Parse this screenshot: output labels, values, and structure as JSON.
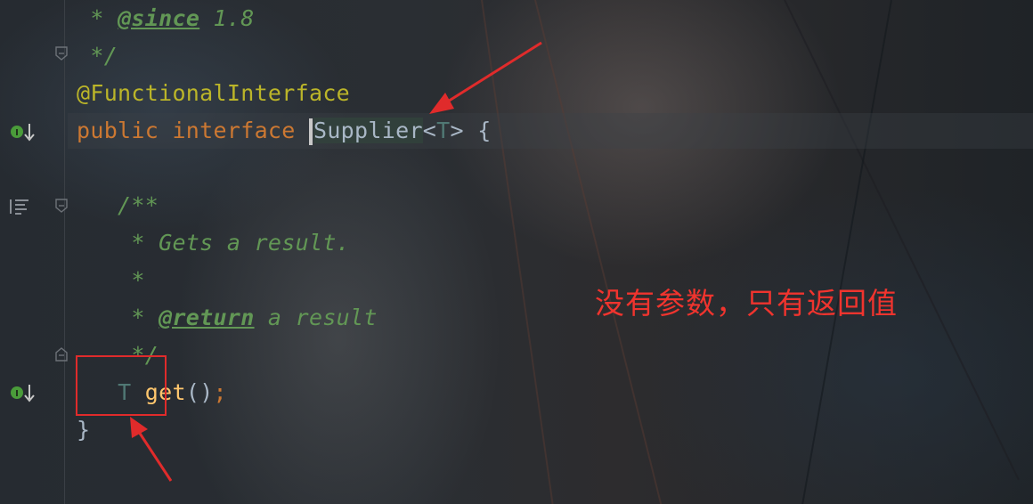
{
  "editor": {
    "lines": [
      {
        "parts": [
          {
            "t": " * ",
            "c": "cmt"
          },
          {
            "t": "@since",
            "c": "tag"
          },
          {
            "t": " 1.8",
            "c": "cmt"
          }
        ]
      },
      {
        "parts": [
          {
            "t": " */",
            "c": "cmt"
          }
        ]
      },
      {
        "parts": [
          {
            "t": "@FunctionalInterface",
            "c": "ann"
          }
        ]
      },
      {
        "parts": [
          {
            "t": "public interface ",
            "c": "kw"
          },
          {
            "t": "Supplier",
            "c": "plain sel"
          },
          {
            "t": "<",
            "c": "plain"
          },
          {
            "t": "T",
            "c": "typ"
          },
          {
            "t": "> {",
            "c": "plain"
          }
        ]
      },
      {
        "parts": []
      },
      {
        "parts": [
          {
            "t": "   /**",
            "c": "cmt"
          }
        ]
      },
      {
        "parts": [
          {
            "t": "    * Gets a result.",
            "c": "cmt"
          }
        ]
      },
      {
        "parts": [
          {
            "t": "    *",
            "c": "cmt"
          }
        ]
      },
      {
        "parts": [
          {
            "t": "    * ",
            "c": "cmt"
          },
          {
            "t": "@return",
            "c": "tag"
          },
          {
            "t": " a result",
            "c": "cmt"
          }
        ]
      },
      {
        "parts": [
          {
            "t": "    */",
            "c": "cmt"
          }
        ]
      },
      {
        "parts": [
          {
            "t": "   ",
            "c": "plain"
          },
          {
            "t": "T",
            "c": "typ"
          },
          {
            "t": " ",
            "c": "plain"
          },
          {
            "t": "get",
            "c": "fn"
          },
          {
            "t": "()",
            "c": "plain"
          },
          {
            "t": ";",
            "c": "kw"
          }
        ]
      },
      {
        "parts": [
          {
            "t": "}",
            "c": "plain"
          }
        ]
      }
    ]
  },
  "gutter": {
    "implemented_marker_label": "I",
    "icons": [
      "implemented-interface-icon",
      "jump-to-implementation-icon",
      "javadoc-render-icon",
      "fold-icon"
    ]
  },
  "annotation": {
    "note_text": "没有参数，只有返回值",
    "color": "#f0342e"
  },
  "colors": {
    "background": "#23272d",
    "comment": "#629755",
    "keyword": "#cc7832",
    "annotation": "#bbb529",
    "identifier": "#a9b7c6",
    "type_param": "#507874",
    "method": "#ffc66d",
    "highlight_red": "#e02b2b"
  }
}
